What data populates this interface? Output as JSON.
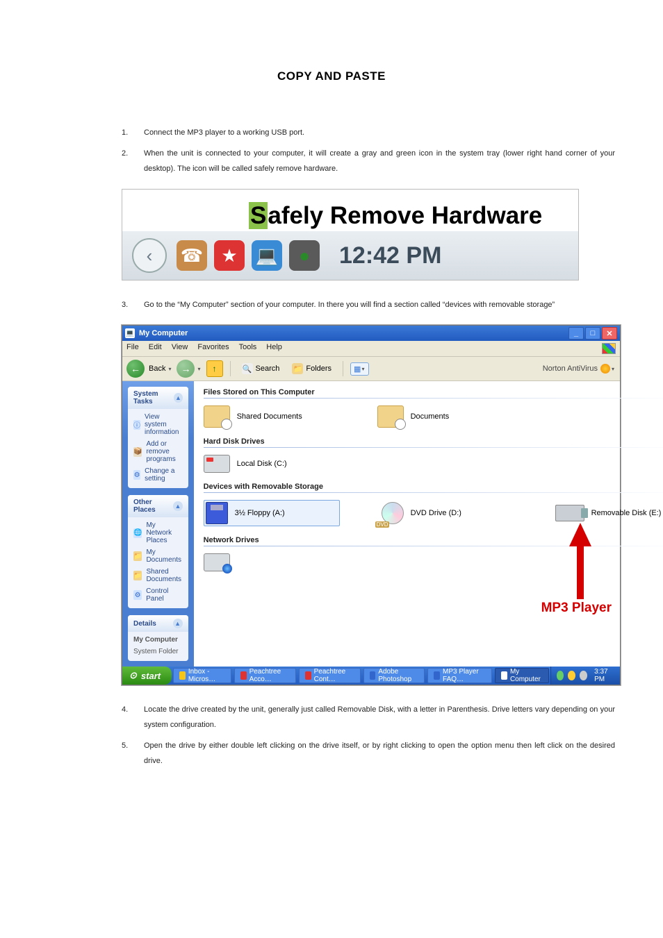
{
  "title": "COPY AND PASTE",
  "steps": {
    "s1": {
      "n": "1.",
      "t": "Connect the MP3 player to a working USB port."
    },
    "s2": {
      "n": "2.",
      "t": "When the unit is connected to your computer, it will create a gray and green icon in the system tray (lower right hand corner of your desktop). The icon will be called safely remove hardware."
    },
    "s3": {
      "n": "3.",
      "t": "Go to the “My Computer” section of your computer. In there you will find a section called “devices with removable storage”"
    },
    "s4": {
      "n": "4.",
      "t": "Locate the drive created by the unit, generally just called Removable Disk, with a letter in Parenthesis. Drive letters vary depending on your system configuration."
    },
    "s5": {
      "n": "5.",
      "t": "Open the drive by either double left clicking on the drive itself, or by right clicking to open the option menu then left click on the desired drive."
    }
  },
  "fig1": {
    "balloon_hl": "S",
    "balloon_rest": "afely Remove Hardware",
    "clock": "12:42 PM"
  },
  "fig2": {
    "title": "My Computer",
    "menus": {
      "file": "File",
      "edit": "Edit",
      "view": "View",
      "fav": "Favorites",
      "tools": "Tools",
      "help": "Help"
    },
    "tb": {
      "back": "Back",
      "search": "Search",
      "folders": "Folders",
      "norton": "Norton AntiVirus"
    },
    "side": {
      "tasks": {
        "title": "System Tasks",
        "i1": "View system information",
        "i2": "Add or remove programs",
        "i3": "Change a setting"
      },
      "places": {
        "title": "Other Places",
        "i1": "My Network Places",
        "i2": "My Documents",
        "i3": "Shared Documents",
        "i4": "Control Panel"
      },
      "details": {
        "title": "Details",
        "l1": "My Computer",
        "l2": "System Folder"
      }
    },
    "content": {
      "g1": "Files Stored on This Computer",
      "g2": "Hard Disk Drives",
      "g3": "Devices with Removable Storage",
      "g4": "Network Drives",
      "shared": "Shared Documents",
      "userdocs": "Documents",
      "local": "Local Disk (C:)",
      "floppy": "3½ Floppy (A:)",
      "dvd": "DVD Drive (D:)",
      "dvdlabel": "DVD",
      "rem": "Removable Disk (E:)",
      "netdrv_a": "",
      "netdrv_b": "",
      "mp3": "MP3 Player"
    },
    "taskbar": {
      "start": "start",
      "t1": "Inbox - Micros…",
      "t2": "Peachtree Acco…",
      "t3": "Peachtree Cont…",
      "t4": "Adobe Photoshop",
      "t5": "MP3 Player FAQ…",
      "t6": "My Computer",
      "time": "3:37 PM"
    }
  }
}
